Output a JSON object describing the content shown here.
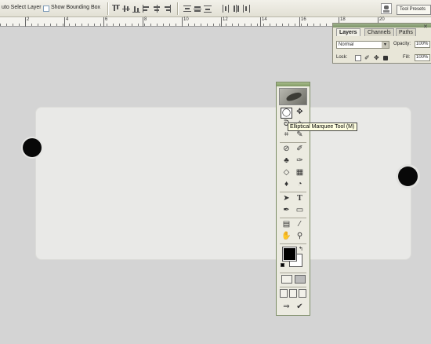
{
  "options_bar": {
    "auto_select_label": "uto Select Layer",
    "show_bounding_box_label": "Show Bounding Box",
    "tool_presets_label": "Tool Presets"
  },
  "ruler": {
    "labels": [
      "2",
      "4",
      "6",
      "8",
      "10",
      "12",
      "14",
      "16",
      "18",
      "20"
    ]
  },
  "layers_panel": {
    "tabs": [
      "Layers",
      "Channels",
      "Paths"
    ],
    "active_tab": "Layers",
    "blend_mode": "Normal",
    "opacity_label": "Opacity:",
    "opacity_value": "100%",
    "lock_label": "Lock:",
    "fill_label": "Fill:",
    "fill_value": "100%"
  },
  "toolbox": {
    "selected_tool": "elliptical-marquee-tool",
    "foreground_color": "#000000",
    "background_color": "#ffffff",
    "tools": [
      "elliptical-marquee-tool",
      "move-tool",
      "lasso-tool",
      "magic-wand-tool",
      "crop-tool",
      "slice-tool",
      "healing-brush-tool",
      "brush-tool",
      "clone-stamp-tool",
      "history-brush-tool",
      "eraser-tool",
      "gradient-tool",
      "blur-tool",
      "dodge-tool",
      "path-selection-tool",
      "type-tool",
      "pen-tool",
      "shape-tool",
      "notes-tool",
      "eyedropper-tool",
      "hand-tool",
      "zoom-tool"
    ]
  },
  "tooltip": {
    "text": "Elliptical Marquee Tool (M)"
  },
  "colors": {
    "canvas_bg": "#d4d4d4",
    "document_panel": "#e9e9e7",
    "hole": "#080808",
    "panel_accent": "#809a63"
  }
}
